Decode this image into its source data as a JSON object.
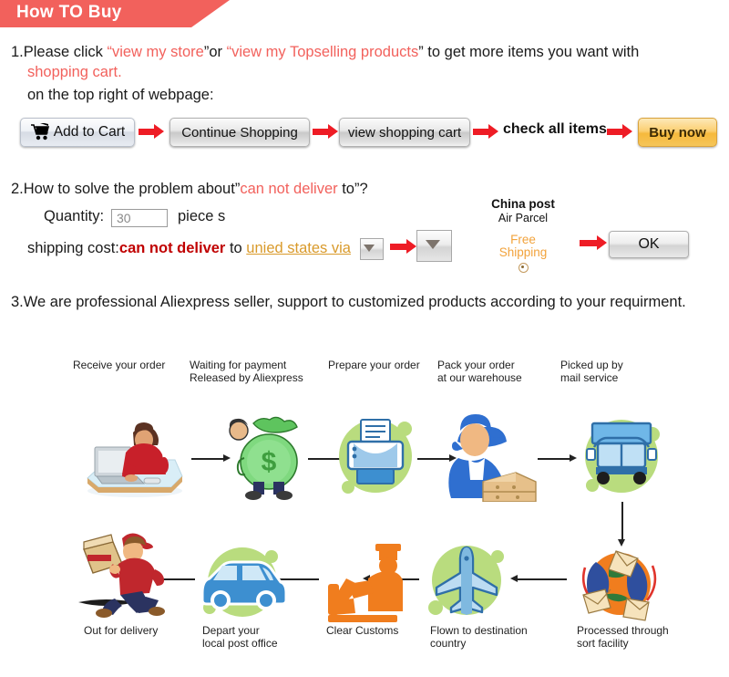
{
  "header": {
    "title": "How TO Buy",
    "banner_color": "#f2615c"
  },
  "steps": {
    "one": {
      "number": "1.",
      "lead": "Please click ",
      "q1open": "“",
      "link1": "view my store",
      "q1close": "”",
      "mid": "or ",
      "q2open": "“",
      "link2": "view my Topselling products",
      "q2close": "”",
      "tail": " to get more items you want with",
      "line2": "shopping cart.",
      "line3": "on the top right of webpage:"
    },
    "two": {
      "number": "2.",
      "text_before": "How to solve the problem about”",
      "highlight": "can not deliver",
      "text_after": " to”?",
      "quantity_label": "Quantity:",
      "quantity_value": "30",
      "unit_label": "piece s",
      "shipping_label": "shipping cost:",
      "shipping_warning": "can not deliver",
      "shipping_to": " to ",
      "country_link": "unied states via"
    },
    "three": {
      "number": "3.",
      "text": "We are professional Aliexpress seller, support to customized products according to your requirment."
    }
  },
  "buttons": {
    "add_to_cart": "Add to Cart",
    "continue_shopping": "Continue Shopping",
    "view_shopping_cart": "view shopping cart",
    "check_all_items": "check all items",
    "buy_now": "Buy now",
    "ok": "OK"
  },
  "shipping_panel": {
    "carrier": "China post",
    "service": "Air Parcel",
    "free_line1": "Free",
    "free_line2": "Shipping"
  },
  "flow": {
    "top_labels": [
      "Receive your order",
      "Waiting for payment\nReleased by Aliexpress",
      "Prepare your order",
      "Pack your order\nat our warehouse",
      "Picked up by\nmail service"
    ],
    "bottom_labels": [
      "Out for delivery",
      "Depart your\nlocal post office",
      "Clear Customs",
      "Flown to destination\ncountry",
      "Processed through\nsort facility"
    ],
    "top_icons": [
      "person-at-computer-icon",
      "money-bag-icon",
      "printer-icon",
      "warehouse-worker-icon",
      "delivery-truck-icon"
    ],
    "bottom_icons": [
      "courier-running-icon",
      "delivery-van-icon",
      "customs-officer-icon",
      "airplane-icon",
      "mail-sorting-globe-icon"
    ]
  },
  "colors": {
    "accent_red": "#f2615c",
    "arrow_red": "#ee1c25",
    "warning_red": "#c00000",
    "gold": "#d99a2b",
    "blob_green": "#b9dc7e"
  }
}
